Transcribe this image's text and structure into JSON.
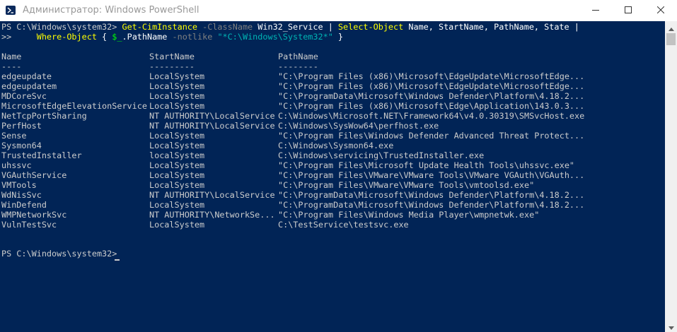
{
  "window": {
    "title": "Администратор: Windows PowerShell",
    "background": "#012456",
    "text_color": "#cccccc",
    "icon": "powershell-icon",
    "controls": [
      "minimize-icon",
      "maximize-icon",
      "close-icon"
    ]
  },
  "command": {
    "prompt": "PS C:\\Windows\\system32>",
    "part1_cmdlet": "Get-CimInstance",
    "part1_param": "-ClassName",
    "part1_arg": "Win32_Service | ",
    "part2_cmdlet": "Select-Object",
    "part2_args": "Name, StartName, PathName, State |",
    "continuation": ">>     ",
    "part3_cmdlet": "Where-Object",
    "part3_open": " { ",
    "part3_var": "$_",
    "part3_prop": ".PathName",
    "part3_param": "-notlike",
    "part3_string": "\"*C:\\Windows\\System32*\"",
    "part3_close": " }"
  },
  "table": {
    "headers": [
      "Name",
      "StartName",
      "PathName"
    ],
    "separators": [
      "----",
      "---------",
      "--------"
    ],
    "rows": [
      [
        "edgeupdate",
        "LocalSystem",
        "\"C:\\Program Files (x86)\\Microsoft\\EdgeUpdate\\MicrosoftEdge..."
      ],
      [
        "edgeupdatem",
        "LocalSystem",
        "\"C:\\Program Files (x86)\\Microsoft\\EdgeUpdate\\MicrosoftEdge..."
      ],
      [
        "MDCoreSvc",
        "LocalSystem",
        "\"C:\\ProgramData\\Microsoft\\Windows Defender\\Platform\\4.18.2..."
      ],
      [
        "MicrosoftEdgeElevationService",
        "LocalSystem",
        "\"C:\\Program Files (x86)\\Microsoft\\Edge\\Application\\143.0.3..."
      ],
      [
        "NetTcpPortSharing",
        "NT AUTHORITY\\LocalService",
        "C:\\Windows\\Microsoft.NET\\Framework64\\v4.0.30319\\SMSvcHost.exe"
      ],
      [
        "PerfHost",
        "NT AUTHORITY\\LocalService",
        "C:\\Windows\\SysWow64\\perfhost.exe"
      ],
      [
        "Sense",
        "LocalSystem",
        "\"C:\\Program Files\\Windows Defender Advanced Threat Protect..."
      ],
      [
        "Sysmon64",
        "LocalSystem",
        "C:\\Windows\\Sysmon64.exe"
      ],
      [
        "TrustedInstaller",
        "localSystem",
        "C:\\Windows\\servicing\\TrustedInstaller.exe"
      ],
      [
        "uhssvc",
        "LocalSystem",
        "\"C:\\Program Files\\Microsoft Update Health Tools\\uhssvc.exe\""
      ],
      [
        "VGAuthService",
        "LocalSystem",
        "\"C:\\Program Files\\VMware\\VMware Tools\\VMware VGAuth\\VGAuth..."
      ],
      [
        "VMTools",
        "LocalSystem",
        "\"C:\\Program Files\\VMware\\VMware Tools\\vmtoolsd.exe\""
      ],
      [
        "WdNisSvc",
        "NT AUTHORITY\\LocalService",
        "\"C:\\ProgramData\\Microsoft\\Windows Defender\\Platform\\4.18.2..."
      ],
      [
        "WinDefend",
        "LocalSystem",
        "\"C:\\ProgramData\\Microsoft\\Windows Defender\\Platform\\4.18.2..."
      ],
      [
        "WMPNetworkSvc",
        "NT AUTHORITY\\NetworkSe...",
        "\"C:\\Program Files\\Windows Media Player\\wmpnetwk.exe\""
      ],
      [
        "VulnTestSvc",
        "LocalSystem",
        "C:\\TestService\\testsvc.exe"
      ]
    ]
  },
  "final_prompt": "PS C:\\Windows\\system32>"
}
